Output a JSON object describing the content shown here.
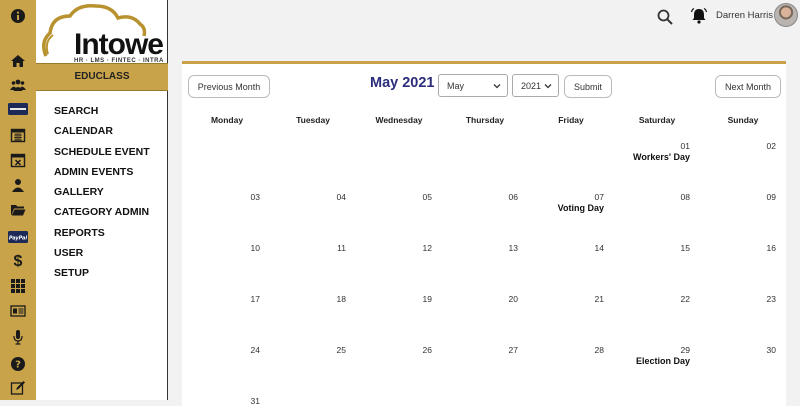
{
  "rail_icons": [
    "info-icon",
    "home-icon",
    "users-icon",
    "card-icon",
    "calendar-icon",
    "calendar-x-icon",
    "user-icon",
    "folder-icon",
    "paypal-icon",
    "dollar-icon",
    "grid-icon",
    "id-card-icon",
    "microphone-icon",
    "help-icon",
    "edit-icon"
  ],
  "logo": {
    "brand": "Intowe",
    "tag": "HR · LMS · FINTEC · INTRA"
  },
  "sidebar": {
    "section_title": "EDUCLASS",
    "items": [
      "SEARCH",
      "CALENDAR",
      "SCHEDULE EVENT",
      "ADMIN EVENTS",
      "GALLERY",
      "CATEGORY ADMIN",
      "REPORTS",
      "USER",
      "SETUP"
    ]
  },
  "topbar": {
    "user_name": "Darren Harris"
  },
  "calendar": {
    "prev_label": "Previous Month",
    "next_label": "Next Month",
    "title": "May 2021",
    "month_select": "May",
    "year_select": "2021",
    "submit_label": "Submit",
    "weekdays": [
      "Monday",
      "Tuesday",
      "Wednesday",
      "Thursday",
      "Friday",
      "Saturday",
      "Sunday"
    ],
    "weeks": [
      [
        "",
        "",
        "",
        "",
        "",
        "01",
        "02"
      ],
      [
        "03",
        "04",
        "05",
        "06",
        "07",
        "08",
        "09"
      ],
      [
        "10",
        "11",
        "12",
        "13",
        "14",
        "15",
        "16"
      ],
      [
        "17",
        "18",
        "19",
        "20",
        "21",
        "22",
        "23"
      ],
      [
        "24",
        "25",
        "26",
        "27",
        "28",
        "29",
        "30"
      ],
      [
        "31",
        "",
        "",
        "",
        "",
        "",
        ""
      ]
    ],
    "events": [
      {
        "day": "01",
        "title": "Workers' Day"
      },
      {
        "day": "07",
        "title": "Voting Day"
      },
      {
        "day": "29",
        "title": "Election Day"
      }
    ]
  },
  "colors": {
    "accent": "#c8a349",
    "title": "#2b2d7a"
  }
}
